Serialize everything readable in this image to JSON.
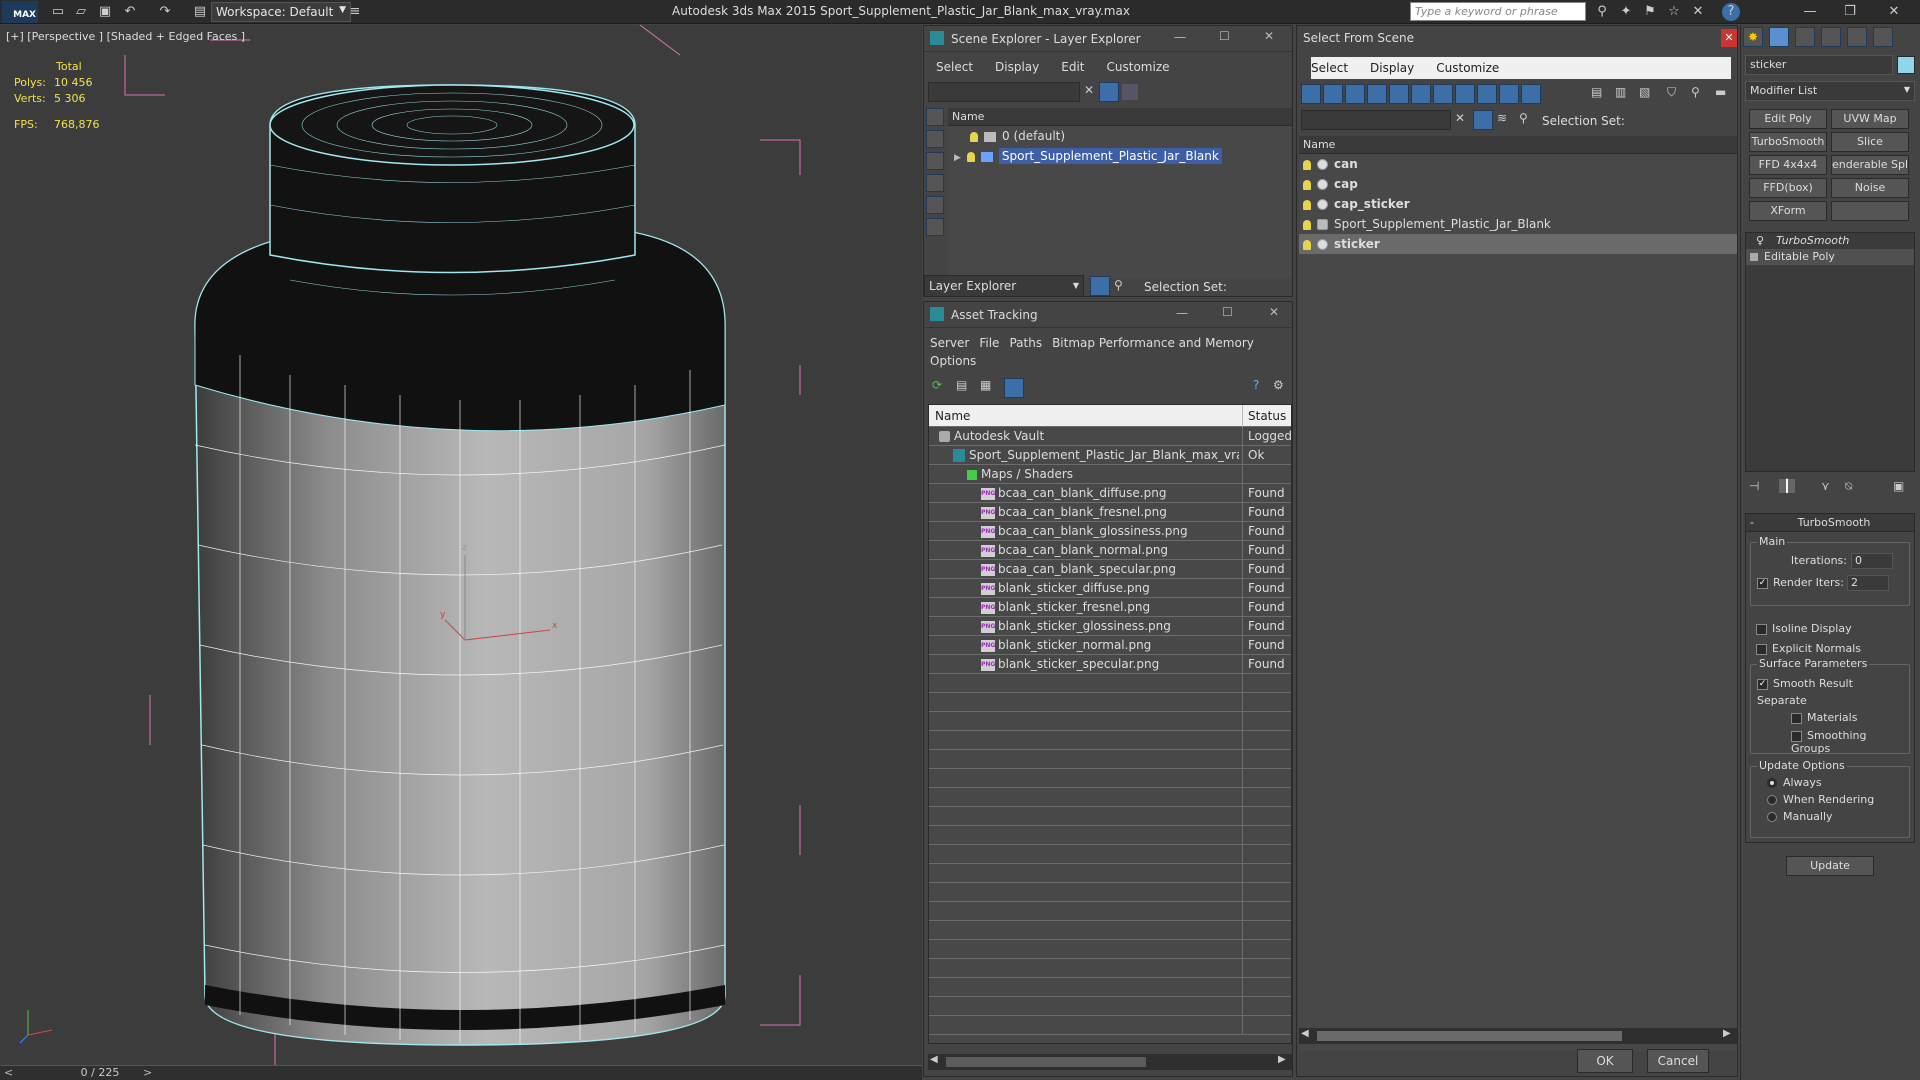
{
  "app": {
    "title": "Autodesk 3ds Max  2015    Sport_Supplement_Plastic_Jar_Blank_max_vray.max",
    "logo": "MAX",
    "workspace": "Workspace: Default",
    "search_placeholder": "Type a keyword or phrase"
  },
  "viewport": {
    "label": "[+] [Perspective ] [Shaded + Edged Faces ]",
    "stats": {
      "total_label": "Total",
      "polys_label": "Polys:",
      "polys": "10 456",
      "verts_label": "Verts:",
      "verts": "5 306",
      "fps_label": "FPS:",
      "fps": "768,876"
    },
    "axis": {
      "x": "x",
      "y": "y",
      "z": "z"
    },
    "timeline": "0 / 225",
    "timeline_prev": "<",
    "timeline_next": ">"
  },
  "layer_explorer": {
    "title": "Scene Explorer - Layer Explorer",
    "menu": [
      "Select",
      "Display",
      "Edit",
      "Customize"
    ],
    "col_name": "Name",
    "rows": [
      "0 (default)",
      "Sport_Supplement_Plastic_Jar_Blank"
    ],
    "footer_dropdown": "Layer Explorer",
    "selection_set": "Selection Set:"
  },
  "asset_tracking": {
    "title": "Asset Tracking",
    "menu": [
      "Server",
      "File",
      "Paths",
      "Bitmap Performance and Memory"
    ],
    "menu2": "Options",
    "col_name": "Name",
    "col_status": "Status",
    "rows": [
      {
        "name": "Autodesk Vault",
        "status": "Logged",
        "indent": 0,
        "kind": "vault"
      },
      {
        "name": "Sport_Supplement_Plastic_Jar_Blank_max_vray....",
        "status": "Ok",
        "indent": 1,
        "kind": "max"
      },
      {
        "name": "Maps / Shaders",
        "status": "",
        "indent": 2,
        "kind": "maps"
      },
      {
        "name": "bcaa_can_blank_diffuse.png",
        "status": "Found",
        "indent": 3,
        "kind": "png"
      },
      {
        "name": "bcaa_can_blank_fresnel.png",
        "status": "Found",
        "indent": 3,
        "kind": "png"
      },
      {
        "name": "bcaa_can_blank_glossiness.png",
        "status": "Found",
        "indent": 3,
        "kind": "png"
      },
      {
        "name": "bcaa_can_blank_normal.png",
        "status": "Found",
        "indent": 3,
        "kind": "png"
      },
      {
        "name": "bcaa_can_blank_specular.png",
        "status": "Found",
        "indent": 3,
        "kind": "png"
      },
      {
        "name": "blank_sticker_diffuse.png",
        "status": "Found",
        "indent": 3,
        "kind": "png"
      },
      {
        "name": "blank_sticker_fresnel.png",
        "status": "Found",
        "indent": 3,
        "kind": "png"
      },
      {
        "name": "blank_sticker_glossiness.png",
        "status": "Found",
        "indent": 3,
        "kind": "png"
      },
      {
        "name": "blank_sticker_normal.png",
        "status": "Found",
        "indent": 3,
        "kind": "png"
      },
      {
        "name": "blank_sticker_specular.png",
        "status": "Found",
        "indent": 3,
        "kind": "png"
      }
    ],
    "png_badge": "PNG"
  },
  "select_from_scene": {
    "title": "Select From Scene",
    "menu": [
      "Select",
      "Display",
      "Customize"
    ],
    "selection_set": "Selection Set:",
    "col_name": "Name",
    "rows": [
      {
        "name": "can",
        "bold": true,
        "selected": false
      },
      {
        "name": "cap",
        "bold": true,
        "selected": false
      },
      {
        "name": "cap_sticker",
        "bold": true,
        "selected": false
      },
      {
        "name": "Sport_Supplement_Plastic_Jar_Blank",
        "bold": false,
        "selected": false
      },
      {
        "name": "sticker",
        "bold": true,
        "selected": true
      }
    ],
    "ok": "OK",
    "cancel": "Cancel"
  },
  "command_panel": {
    "object_name": "sticker",
    "modifier_list": "Modifier List",
    "buttons": [
      "Edit Poly",
      "UVW Map",
      "TurboSmooth",
      "Slice",
      "FFD 4x4x4",
      "enderable Splir",
      "FFD(box)",
      "Noise",
      "XForm",
      ""
    ],
    "stack": [
      "TurboSmooth",
      "Editable Poly"
    ],
    "rollout_title": "TurboSmooth",
    "main_label": "Main",
    "iterations_label": "Iterations:",
    "iterations": "0",
    "render_iters_label": "Render Iters:",
    "render_iters": "2",
    "isoline": "Isoline Display",
    "explicit_normals": "Explicit Normals",
    "surface_params": "Surface Parameters",
    "smooth_result": "Smooth Result",
    "separate": "Separate",
    "materials": "Materials",
    "smoothing_groups": "Smoothing Groups",
    "update_options": "Update Options",
    "always": "Always",
    "when_rendering": "When Rendering",
    "manually": "Manually",
    "update": "Update"
  },
  "colors": {
    "accent": "#3e5ea8",
    "stats": "#f2e24a",
    "wire": "#9fe8f0",
    "bbox": "#e070b0"
  }
}
